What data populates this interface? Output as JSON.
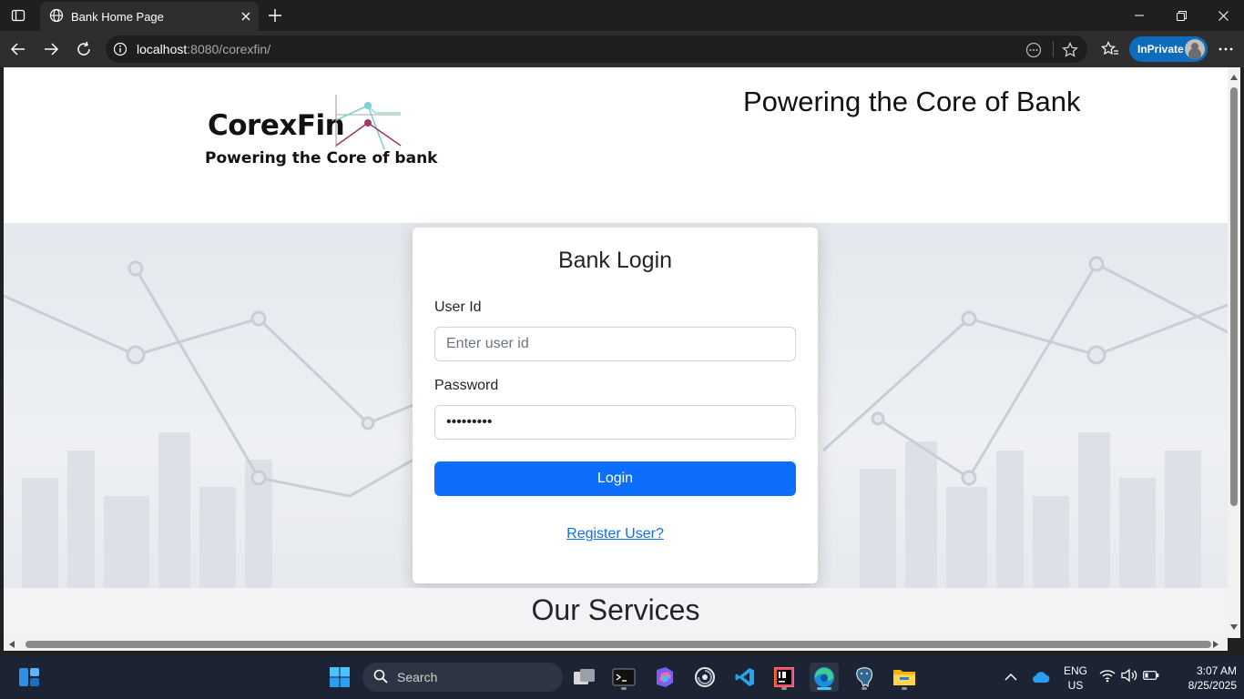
{
  "browser": {
    "tab_title": "Bank Home Page",
    "url_host": "localhost",
    "url_rest": ":8080/corexfin/",
    "inprivate_label": "InPrivate"
  },
  "header": {
    "logo_name": "CorexFin",
    "logo_tagline": "Powering the Core of bank",
    "tagline": "Powering the Core of Bank"
  },
  "login": {
    "title": "Bank Login",
    "userid_label": "User Id",
    "userid_placeholder": "Enter user id",
    "userid_value": "",
    "password_label": "Password",
    "password_value": "secret123",
    "button_label": "Login",
    "register_label": "Register User?"
  },
  "services": {
    "title": "Our Services"
  },
  "taskbar": {
    "search_label": "Search",
    "lang_top": "ENG",
    "lang_bottom": "US",
    "time": "3:07 AM",
    "date": "8/25/2025"
  },
  "colors": {
    "primary": "#0d6efd",
    "inprivate": "#0f6cbd",
    "taskbar": "#1c2333"
  }
}
